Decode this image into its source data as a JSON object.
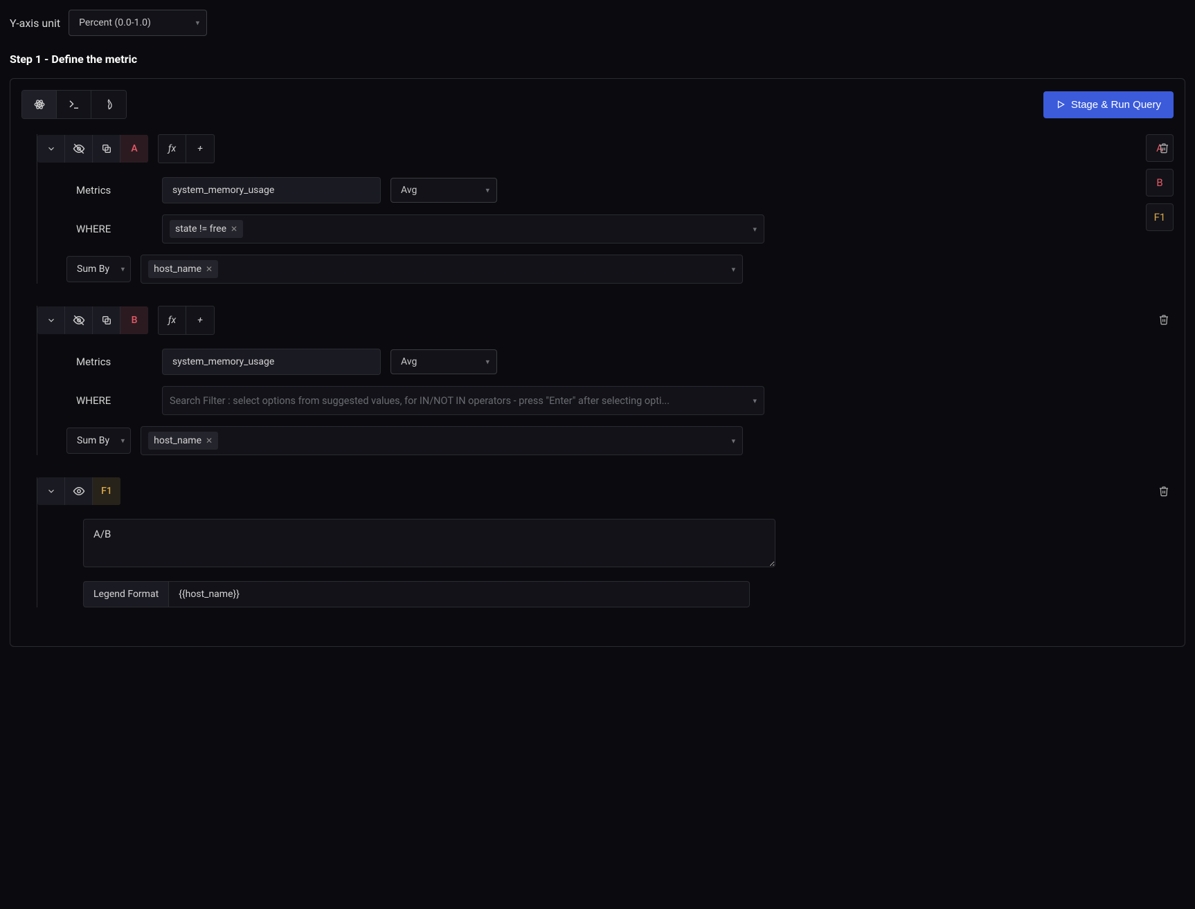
{
  "yAxis": {
    "label": "Y-axis unit",
    "value": "Percent (0.0-1.0)"
  },
  "step1_title": "Step 1 - Define the metric",
  "runButton": "Stage & Run Query",
  "sideTabs": [
    "A",
    "B",
    "F1"
  ],
  "queryA": {
    "letter": "A",
    "metricsLabel": "Metrics",
    "metricName": "system_memory_usage",
    "aggregation": "Avg",
    "whereLabel": "WHERE",
    "whereTag": "state != free",
    "sumByLabel": "Sum By",
    "sumByTag": "host_name"
  },
  "queryB": {
    "letter": "B",
    "metricsLabel": "Metrics",
    "metricName": "system_memory_usage",
    "aggregation": "Avg",
    "whereLabel": "WHERE",
    "wherePlaceholder": "Search Filter : select options from suggested values, for IN/NOT IN operators - press \"Enter\" after selecting opti...",
    "sumByLabel": "Sum By",
    "sumByTag": "host_name"
  },
  "formulaF1": {
    "letter": "F1",
    "expression": "A/B",
    "legendLabel": "Legend Format",
    "legendValue": "{{host_name}}"
  },
  "fx_label": "ƒx",
  "plus": "+"
}
